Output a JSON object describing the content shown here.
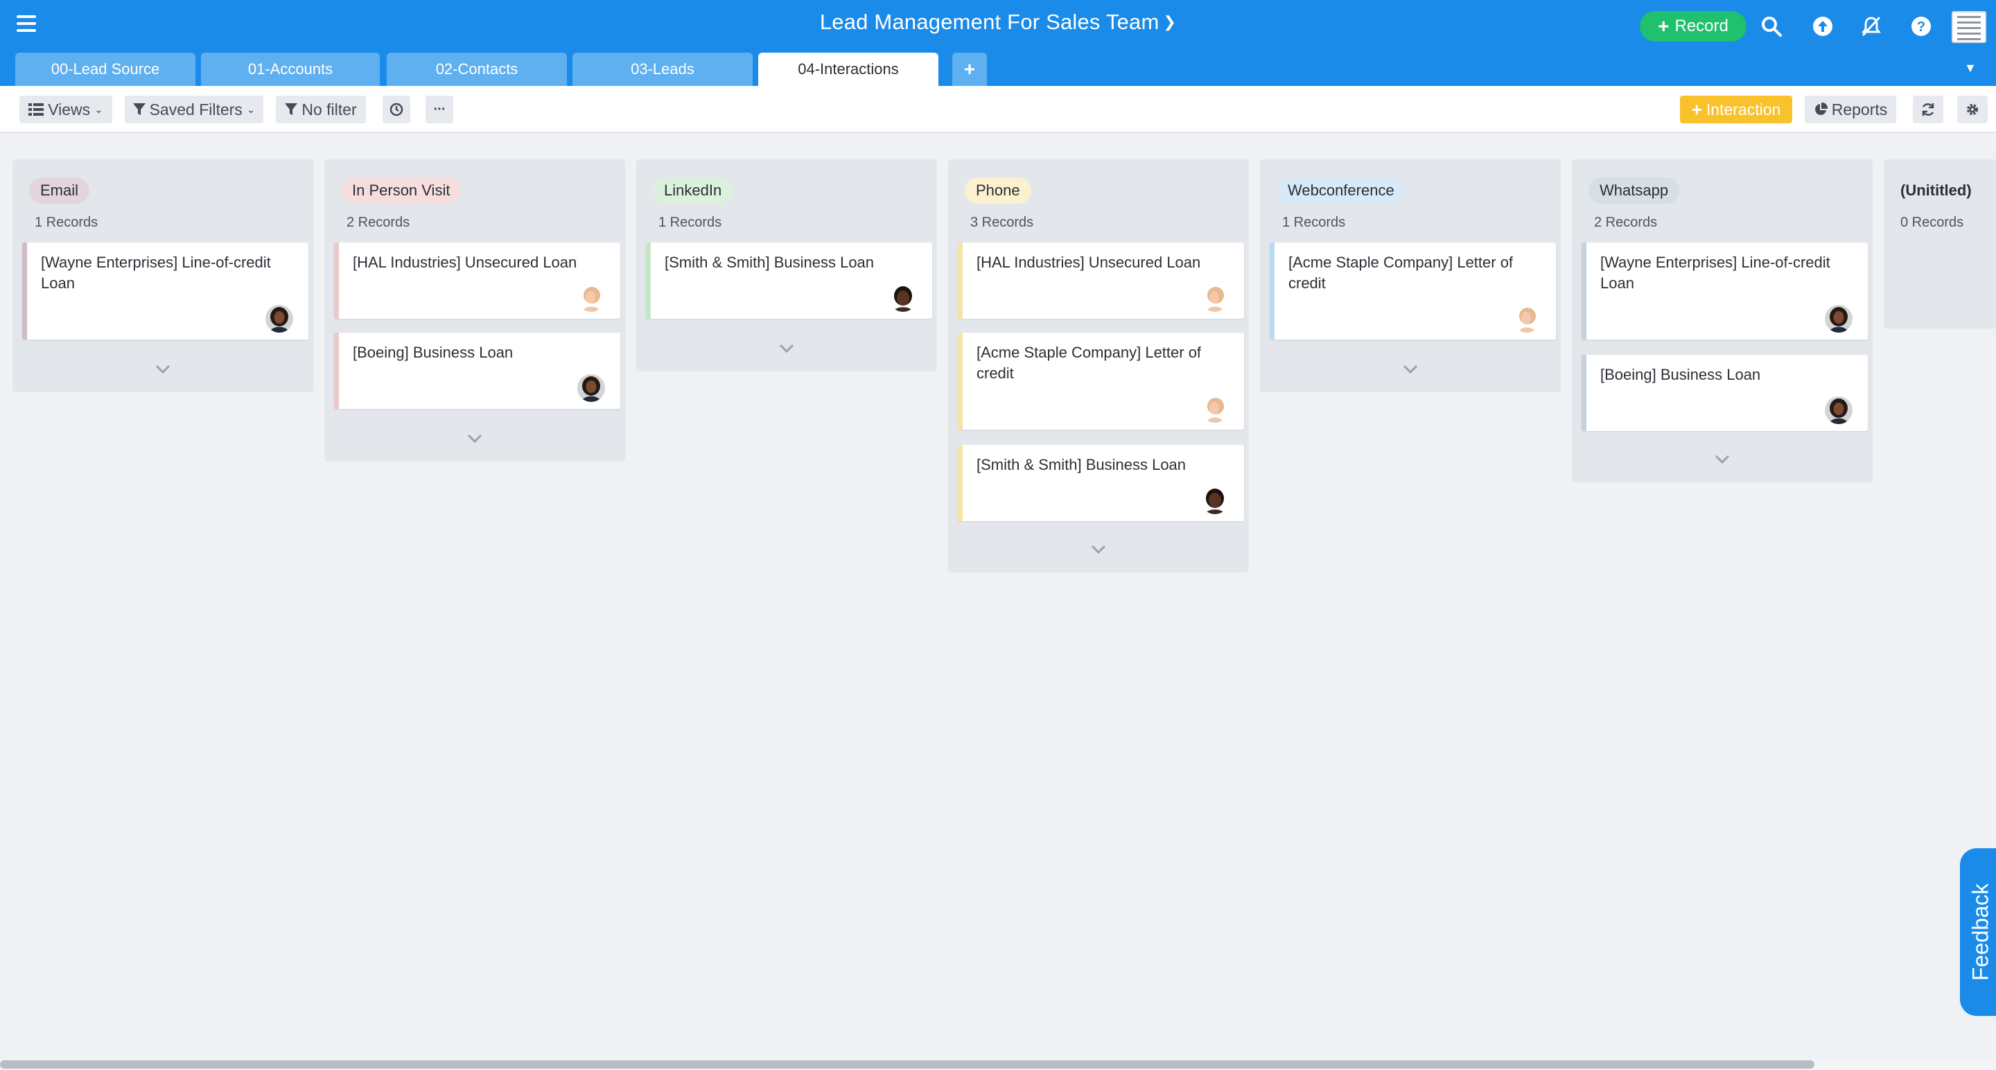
{
  "app": {
    "title": "Lead Management For Sales Team",
    "record_button": "Record"
  },
  "tabs": [
    {
      "label": "00-Lead Source"
    },
    {
      "label": "01-Accounts"
    },
    {
      "label": "02-Contacts"
    },
    {
      "label": "03-Leads"
    },
    {
      "label": "04-Interactions",
      "active": true
    }
  ],
  "toolbar": {
    "views": "Views",
    "saved_filters": "Saved Filters",
    "no_filter": "No filter",
    "add_interaction": "Interaction",
    "reports": "Reports"
  },
  "kanban": {
    "lanes": [
      {
        "title": "Email",
        "count": "1 Records",
        "color": "#e2d6dc",
        "cards": [
          {
            "title": "[Wayne Enterprises] Line-of-credit Loan",
            "avatar": "woman-dark-avatar"
          }
        ]
      },
      {
        "title": "In Person Visit",
        "count": "2 Records",
        "color": "#f6dede",
        "cards": [
          {
            "title": "[HAL Industries] Unsecured Loan",
            "avatar": "woman-blonde-avatar"
          },
          {
            "title": "[Boeing] Business Loan",
            "avatar": "woman-dark-avatar"
          }
        ]
      },
      {
        "title": "LinkedIn",
        "count": "1 Records",
        "color": "#dcf1dc",
        "cards": [
          {
            "title": "[Smith & Smith] Business Loan",
            "avatar": "man-avatar"
          }
        ]
      },
      {
        "title": "Phone",
        "count": "3 Records",
        "color": "#fbf1cf",
        "cards": [
          {
            "title": "[HAL Industries] Unsecured Loan",
            "avatar": "woman-blonde-avatar"
          },
          {
            "title": "[Acme Staple Company] Letter of credit",
            "avatar": "woman-blonde-avatar"
          },
          {
            "title": "[Smith & Smith] Business Loan",
            "avatar": "man-avatar"
          }
        ]
      },
      {
        "title": "Webconference",
        "count": "1 Records",
        "color": "#d8eaf8",
        "cards": [
          {
            "title": "[Acme Staple Company] Letter of credit",
            "avatar": "woman-blonde-avatar"
          }
        ]
      },
      {
        "title": "Whatsapp",
        "count": "2 Records",
        "color": "#d6dee6",
        "cards": [
          {
            "title": "[Wayne Enterprises] Line-of-credit Loan",
            "avatar": "woman-dark-avatar"
          },
          {
            "title": "[Boeing] Business Loan",
            "avatar": "woman-dark-avatar"
          }
        ]
      },
      {
        "title": "(Unititled)",
        "count": "0 Records",
        "color": "#e3e6ea",
        "cards": []
      }
    ]
  },
  "feedback": "Feedback",
  "colors": {
    "brand": "#1a8be8",
    "record_button": "#1fc06e",
    "interaction_button": "#f7c22c"
  }
}
